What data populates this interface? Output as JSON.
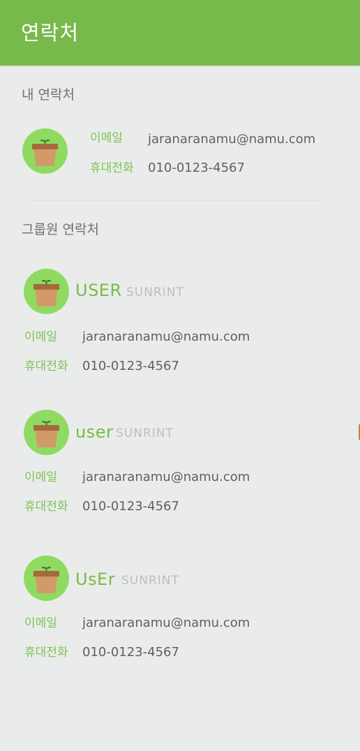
{
  "header": {
    "title": "연락처",
    "color": "#78b94b"
  },
  "my_contact": {
    "section_title": "내 연락처",
    "avatar_icon": "plant-pot-icon",
    "email_label": "이메일",
    "email": "jaranaranamu@namu.com",
    "phone_label": "휴대전화",
    "phone": "010-0123-4567"
  },
  "group": {
    "section_title": "그룹원 연락처",
    "members": [
      {
        "name": "USER",
        "org": "SUNRINT",
        "avatar_icon": "plant-pot-icon",
        "email_label": "이메일",
        "email": "jaranaranamu@namu.com",
        "phone_label": "휴대전화",
        "phone": "010-0123-4567"
      },
      {
        "name": "user",
        "org": "SUNRINT",
        "avatar_icon": "plant-pot-icon",
        "email_label": "이메일",
        "email": "jaranaranamu@namu.com",
        "phone_label": "휴대전화",
        "phone": "010-0123-4567"
      },
      {
        "name": "UsEr",
        "org": "SUNRINT",
        "avatar_icon": "plant-pot-icon",
        "email_label": "이메일",
        "email": "jaranaranamu@namu.com",
        "phone_label": "휴대전화",
        "phone": "010-0123-4567"
      }
    ]
  },
  "colors": {
    "accent": "#78b94b",
    "label_green": "#7ec257",
    "avatar_green": "#8fdb62",
    "background": "#eaeceb",
    "text": "#5f5f5f",
    "muted": "#bdbdbd"
  }
}
